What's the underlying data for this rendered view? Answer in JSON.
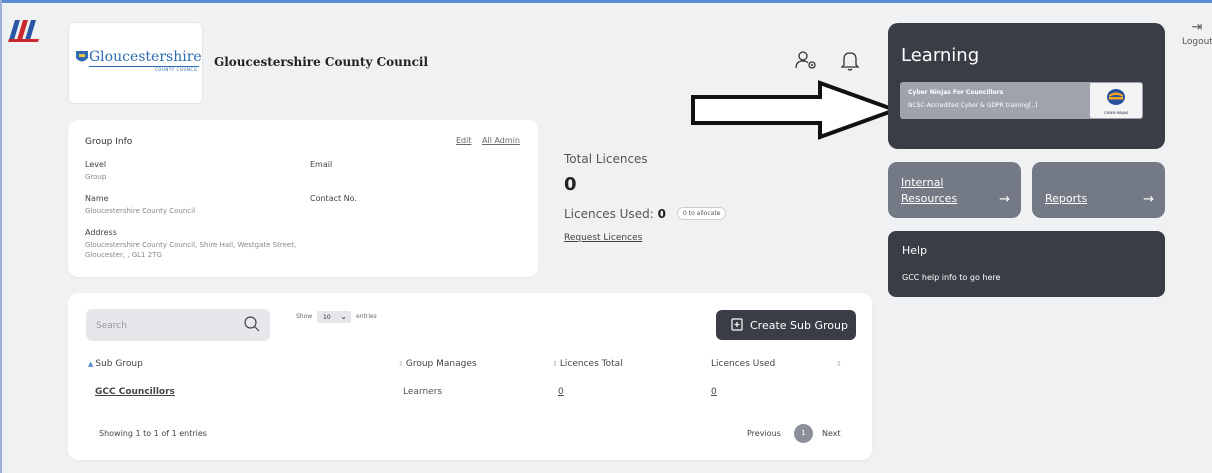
{
  "app": {
    "logout_label": "Logout"
  },
  "org": {
    "logo_text": "Gloucestershire",
    "logo_sub": "COUNTY COUNCIL",
    "name": "Gloucestershire County Council"
  },
  "group_info": {
    "title": "Group Info",
    "edit_label": "Edit",
    "all_admin_label": "All Admin",
    "level_label": "Level",
    "level_value": "Group",
    "email_label": "Email",
    "name_label": "Name",
    "name_value": "Gloucestershire County Council",
    "contact_label": "Contact No.",
    "address_label": "Address",
    "address_line1": "Gloucestershire County Council, Shire Hall, Westgate Street,",
    "address_line2": "Gloucester, , GL1 2TG"
  },
  "licences": {
    "title": "Total Licences",
    "total": "0",
    "used_label": "Licences Used:",
    "used_value": "0",
    "allocate_badge": "0 to allocate",
    "request_link": "Request Licences"
  },
  "learning": {
    "title": "Learning",
    "course_title": "Cyber Ninjas For Councillors",
    "course_desc": "NCSC-Accredited Cyber & GDPR training[..]",
    "thumb_label": "CYBER NINJAS"
  },
  "tiles": {
    "internal_line1": "Internal",
    "internal_line2": "Resources",
    "reports": "Reports",
    "arrow": "→"
  },
  "help": {
    "title": "Help",
    "desc": "GCC help info to go here"
  },
  "subgroups": {
    "search_placeholder": "Search",
    "show_label": "Show",
    "show_value": "10",
    "entries_label": "entries",
    "create_button": "Create Sub Group",
    "columns": [
      "Sub Group",
      "Group Manages",
      "Licences Total",
      "Licences Used"
    ],
    "rows": [
      {
        "sub_group": "GCC Councillors",
        "manages": "Learners",
        "total": "0",
        "used": "0"
      }
    ],
    "showing": "Showing 1 to 1 of 1 entries",
    "previous": "Previous",
    "page": "1",
    "next": "Next"
  },
  "colors": {
    "dark_panel": "#3a3d45",
    "tile": "#737985",
    "accent_blue": "#2e6bb3"
  }
}
